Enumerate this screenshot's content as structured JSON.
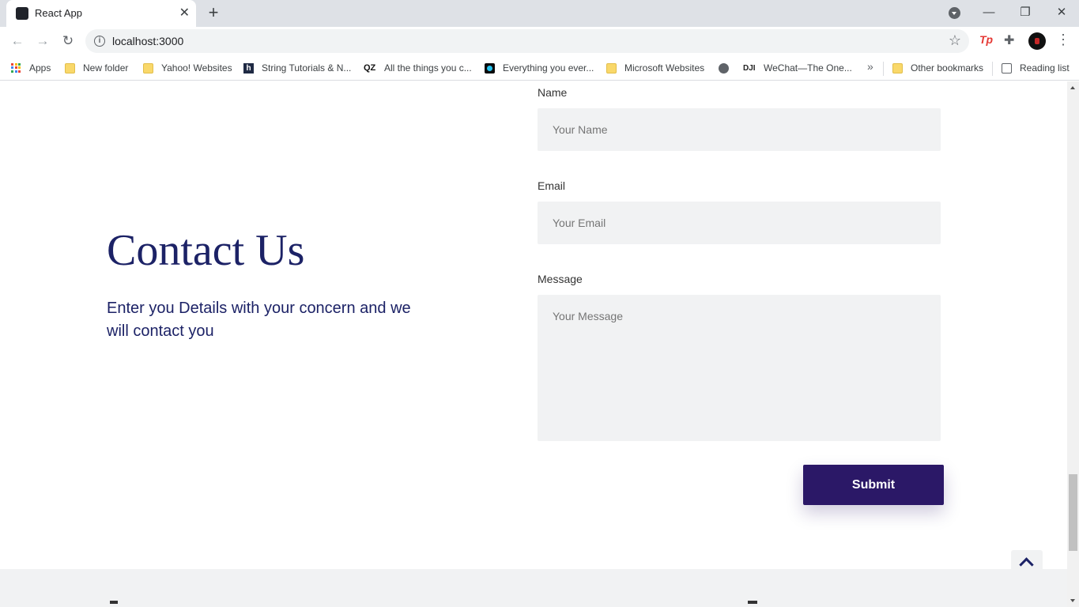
{
  "browser": {
    "tab_title": "React App",
    "tab_close": "✕",
    "new_tab": "+",
    "url": "localhost:3000",
    "window": {
      "minimize": "—",
      "restore": "❐",
      "close": "✕"
    },
    "ext_tp_label": "Tp"
  },
  "bookmarks": {
    "items": [
      {
        "label": "Apps",
        "icon": "apps-grid-icon"
      },
      {
        "label": "New folder",
        "icon": "folder-icon"
      },
      {
        "label": "Yahoo! Websites",
        "icon": "folder-icon"
      },
      {
        "label": "String Tutorials & N...",
        "icon": "hashnode-icon"
      },
      {
        "label": "All the things you c...",
        "icon": "qz-icon"
      },
      {
        "label": "Everything you ever...",
        "icon": "site-icon"
      },
      {
        "label": "Microsoft Websites",
        "icon": "folder-icon"
      },
      {
        "label": "",
        "icon": "globe-icon"
      },
      {
        "label": "WeChat—The One...",
        "icon": "dji-icon"
      }
    ],
    "more": "»",
    "other": "Other bookmarks",
    "reading_list": "Reading list"
  },
  "page": {
    "heading": "Contact Us",
    "subtext": "Enter you Details with your concern and we will contact you",
    "form": {
      "name_label": "Name",
      "name_placeholder": "Your Name",
      "email_label": "Email",
      "email_placeholder": "Your Email",
      "message_label": "Message",
      "message_placeholder": "Your Message",
      "submit": "Submit"
    }
  },
  "colors": {
    "heading": "#1c2266",
    "submit_bg": "#2b1867",
    "field_bg": "#f1f2f3"
  }
}
